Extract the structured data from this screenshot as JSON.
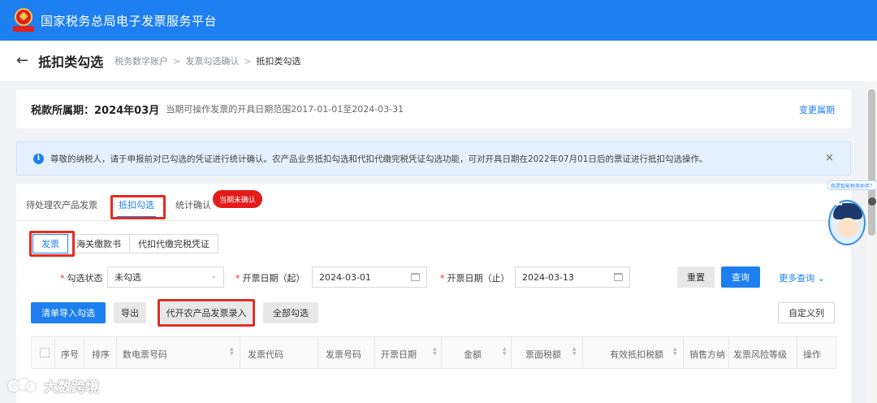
{
  "header": {
    "app_title": "国家税务总局电子发票服务平台"
  },
  "page": {
    "title": "抵扣类勾选",
    "breadcrumb": [
      "税务数字账户",
      "发票勾选确认",
      "抵扣类勾选"
    ]
  },
  "period": {
    "label": "税款所属期：2024年03月",
    "range_text": "当期可操作发票的开具日期范围2017-01-01至2024-03-31",
    "change_link": "变更属期"
  },
  "notice": {
    "text": "尊敬的纳税人，请于申报前对已勾选的凭证进行统计确认。农产品业务抵扣勾选和代扣代缴完税凭证勾选功能，可对开具日期在2022年07月01日后的票证进行抵扣勾选操作。",
    "close": "×"
  },
  "tabs": {
    "items": [
      "待处理农产品发票",
      "抵扣勾选",
      "统计确认"
    ],
    "active": "抵扣勾选",
    "badge": "当期未确认"
  },
  "subtabs": {
    "items": [
      "发票",
      "海关缴款书",
      "代扣代缴完税凭证"
    ],
    "active": "发票"
  },
  "filters": {
    "status_label": "勾选状态",
    "status_value": "未勾选",
    "start_label": "开票日期（起）",
    "start_value": "2024-03-01",
    "end_label": "开票日期（止）",
    "end_value": "2024-03-13",
    "reset": "重置",
    "query": "查询",
    "more": "更多查询"
  },
  "actions": {
    "import": "清单导入勾选",
    "export": "导出",
    "agri_entry": "代开农产品发票录入",
    "select_all": "全部勾选",
    "custom_cols": "自定义列"
  },
  "table": {
    "columns": [
      "序号",
      "排序",
      "数电票号码",
      "发票代码",
      "发票号码",
      "开票日期",
      "金额",
      "票面税额",
      "有效抵扣税额",
      "销售方纳",
      "发票风险等级",
      "操作"
    ]
  },
  "assistant": {
    "bubble": "我是智能税务助手？",
    "chars": [
      "征",
      "纳",
      "互",
      "动"
    ]
  },
  "watermark": {
    "text": "大数跨境"
  },
  "colors": {
    "primary": "#1d7ff0",
    "highlight": "#e42b20",
    "badge": "#e41b1b"
  }
}
